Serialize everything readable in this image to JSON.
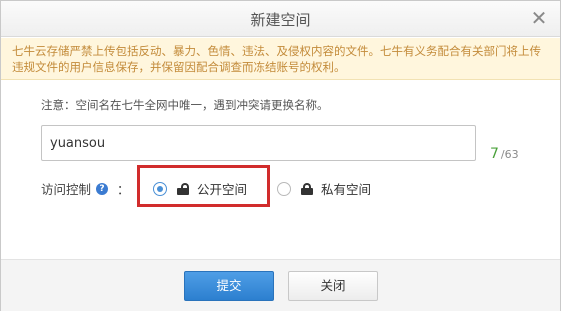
{
  "dialog": {
    "title": "新建空间",
    "close_glyph": "✕"
  },
  "notice": {
    "text": "七牛云存储严禁上传包括反动、暴力、色情、违法、及侵权内容的文件。七牛有义务配合有关部门将上传违规文件的用户信息保存，并保留因配合调查而冻结账号的权利。"
  },
  "form": {
    "hint": "注意：空间名在七牛全网中唯一，遇到冲突请更换名称。",
    "space_name_value": "yuansou",
    "char_count_current": "7",
    "char_count_max": "/63",
    "access_label": "访问控制",
    "help_glyph": "?",
    "colon": "：",
    "access_options": [
      {
        "label": "公开空间",
        "icon": "unlock-icon",
        "checked": true
      },
      {
        "label": "私有空间",
        "icon": "lock-icon",
        "checked": false
      }
    ]
  },
  "footer": {
    "submit_label": "提交",
    "close_label": "关闭"
  },
  "colors": {
    "highlight_border": "#d12c2c",
    "primary_button": "#2c7fcf",
    "notice_bg": "#fff6dd",
    "notice_text": "#c38b3a",
    "counter_current": "#4aa13a"
  }
}
